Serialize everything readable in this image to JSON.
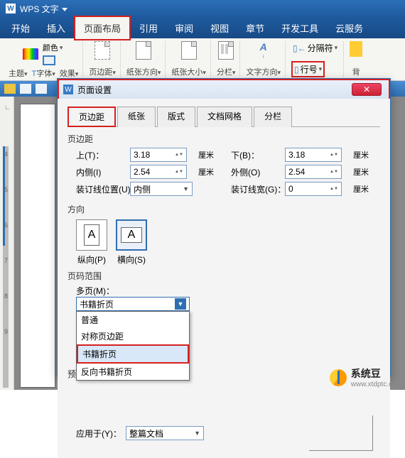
{
  "titlebar": {
    "app": "W",
    "title": "WPS 文字"
  },
  "tabs": [
    "开始",
    "插入",
    "页面布局",
    "引用",
    "审阅",
    "视图",
    "章节",
    "开发工具",
    "云服务"
  ],
  "active_tab_index": 2,
  "ribbon": {
    "theme": {
      "color_label": "颜色",
      "theme_label": "主题",
      "font_label": "字体",
      "effect_label": "效果"
    },
    "margins": "页边距",
    "orientation": "纸张方向",
    "size": "纸张大小",
    "columns": "分栏",
    "text_dir": "文字方向",
    "breaks": "分隔符",
    "line_no": "行号",
    "background": "背"
  },
  "dialog": {
    "title": "页面设置",
    "tabs": [
      "页边距",
      "纸张",
      "版式",
      "文档网格",
      "分栏"
    ],
    "active_tab": 0,
    "section_margins": "页边距",
    "top_label": "上(T)：",
    "bottom_label": "下(B)：",
    "inside_label": "内侧(I)",
    "outside_label": "外侧(O)",
    "gutter_pos_label": "装订线位置(U)：",
    "gutter_width_label": "装订线宽(G)：",
    "top_val": "3.18",
    "bottom_val": "3.18",
    "inside_val": "2.54",
    "outside_val": "2.54",
    "gutter_pos_val": "内侧",
    "gutter_width_val": "0",
    "unit": "厘米",
    "section_orient": "方向",
    "portrait": "纵向(P)",
    "landscape": "横向(S)",
    "section_range": "页码范围",
    "multi_label": "多页(M)：",
    "multi_val": "书籍折页",
    "multi_opts": [
      "普通",
      "对称页边距",
      "书籍折页",
      "反向书籍折页"
    ],
    "section_preview": "预览",
    "apply_label": "应用于(Y)：",
    "apply_val": "整篇文档"
  },
  "watermark": {
    "brand": "系统豆",
    "url": "www.xtdptc.com"
  },
  "ruler_marks": [
    "4",
    "5",
    "6",
    "7",
    "8",
    "9"
  ]
}
